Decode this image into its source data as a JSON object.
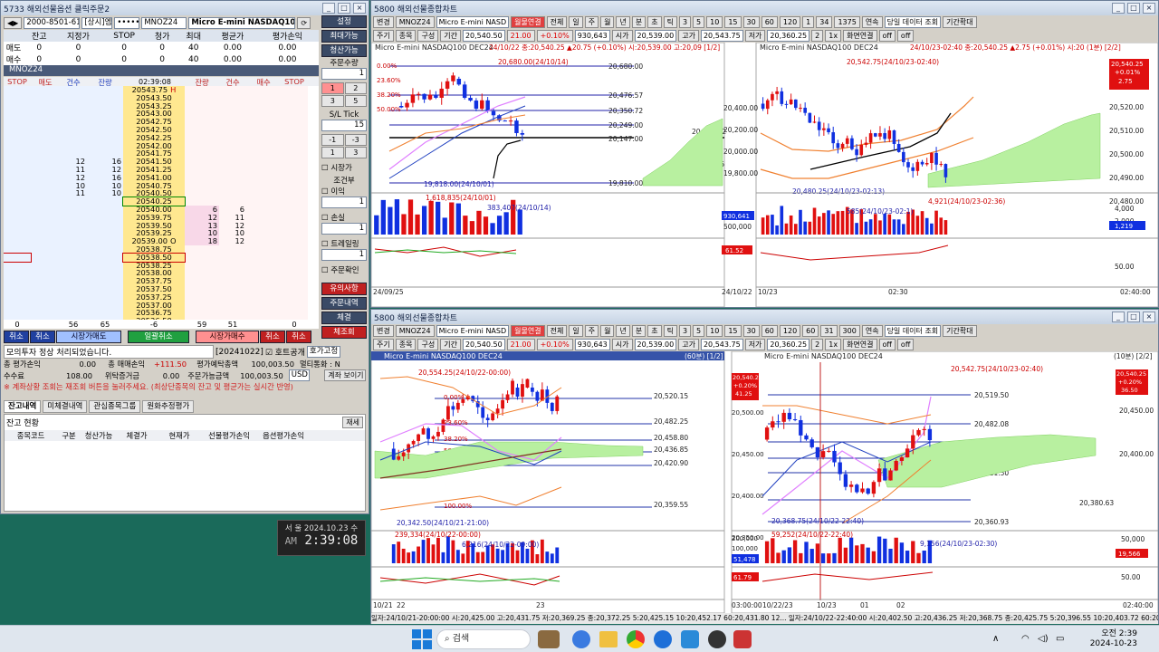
{
  "order": {
    "title": "5733 해외선물옵션 클릭주문2",
    "account": "2000-8501-6145",
    "acct_name": "[상시]엠",
    "password": "•••••",
    "symbol": "MNOZ24",
    "symbol_name": "Micro E-mini NASDAQ100",
    "side_buttons": [
      "설정",
      "최대가능",
      "청산가능"
    ],
    "pos_headers": [
      "",
      "잔고",
      "지정가",
      "STOP",
      "청가",
      "최대",
      "평균가",
      "평가손익"
    ],
    "pos_rows": [
      [
        "매도",
        "0",
        "0",
        "0",
        "0",
        "40",
        "0.00",
        "0.00"
      ],
      [
        "매수",
        "0",
        "0",
        "0",
        "0",
        "40",
        "0.00",
        "0.00"
      ]
    ],
    "sym_tag": "MNOZ24",
    "ob_headers": [
      "STOP",
      "매도",
      "건수",
      "잔량",
      "",
      "잔량",
      "건수",
      "매수",
      "STOP"
    ],
    "time": "02:39:08",
    "prices": [
      "20543.75",
      "20543.50",
      "20543.25",
      "20543.00",
      "20542.75",
      "20542.50",
      "20542.25",
      "20542.00",
      "20541.75",
      "20541.50",
      "20541.25",
      "20541.00",
      "20540.75",
      "20540.50",
      "20540.25",
      "20540.00",
      "20539.75",
      "20539.50",
      "20539.25",
      "20539.00",
      "20538.75",
      "20538.50",
      "20538.25",
      "20538.00",
      "20537.75",
      "20537.50",
      "20537.25",
      "20537.00",
      "20536.75",
      "20536.50"
    ],
    "h_mark": "H",
    "o_mark": "O",
    "ask_cnt": [
      "",
      "",
      "",
      "",
      "",
      "",
      "",
      "",
      "",
      "12",
      "11",
      "12",
      "10",
      "11"
    ],
    "ask_qty": [
      "",
      "",
      "",
      "",
      "",
      "",
      "",
      "",
      "",
      "16",
      "12",
      "16",
      "10",
      "10"
    ],
    "bid_qty": [
      "6",
      "12",
      "13",
      "10",
      "18"
    ],
    "bid_cnt": [
      "6",
      "11",
      "12",
      "10",
      "12"
    ],
    "totals": [
      "0",
      "56",
      "65",
      "-6",
      "59",
      "51",
      "0"
    ],
    "bottom_buttons": [
      "취소",
      "취소",
      "시장가매도",
      "일괄취소",
      "시장가매수",
      "취소",
      "취소"
    ],
    "side": {
      "qty_label": "주문수량",
      "qty": "1",
      "nums": [
        "1",
        "2",
        "3",
        "5"
      ],
      "sl_label": "S/L Tick",
      "sl": "15",
      "steps": [
        "-1",
        "-3",
        "1",
        "3"
      ],
      "mkt": "시장가",
      "cond": "조건부",
      "profit": "이익",
      "loss": "손실",
      "trail": "트레일링",
      "confirm": "주문확인",
      "one": "1",
      "b1": "유의사항",
      "b2": "주문내역",
      "b3": "체결",
      "b4": "체조회"
    },
    "msg": "모의투자 정상 처리되었습니다.",
    "msg_time": "[20241022]",
    "msg_chk": "호트공개",
    "msg_sel": "호가고정",
    "stats": [
      [
        "총 평가손익",
        "0.00",
        "총 매매손익",
        "+111.50",
        "평가예탁총액",
        "100,003.50",
        "멀티통화 : N"
      ],
      [
        "수수료",
        "108.00",
        "위탁증거금",
        "0.00",
        "주문가능금액",
        "100,003.50",
        "USD"
      ]
    ],
    "acct_btn": "계좌 보이기",
    "warn": "※ 계좌상황 조회는 재조회 버튼을 눌러주세요. (최상단종목의 잔고 및 평균가는 실시간 반영)",
    "tabs": [
      "잔고내역",
      "미체결내역",
      "관심종목그룹",
      "원화추정평가"
    ],
    "bal_title": "잔고 현황",
    "refresh": "재세",
    "bal_headers": [
      "종목코드",
      "구분",
      "청산가능",
      "체결가",
      "현재가",
      "선물평가손익",
      "옵션평가손익"
    ]
  },
  "clock": {
    "date": "서 울 2024.10.23 수",
    "ampm": "AM",
    "time": "2:39:08"
  },
  "chart_top": {
    "title": "5800 해외선물종합차트",
    "toolbar": [
      "변경",
      "MNOZ24",
      "Micro E-mini NASD",
      "월물연결",
      "전체",
      "일",
      "주",
      "월",
      "년",
      "분",
      "초",
      "틱",
      "3",
      "5",
      "10",
      "15",
      "30",
      "60",
      "120",
      "1",
      "34",
      "1375",
      "연속",
      "당일 데이터 조회",
      "기간확대"
    ],
    "bar2": [
      "주기",
      "종목",
      "구성",
      "기간",
      "20,540.50",
      "21.00",
      "+0.10%",
      "930,643",
      "시가",
      "20,539.00",
      "고가",
      "20,543.75",
      "저가",
      "20,360.25",
      "2",
      "1x",
      "화면연결",
      "off",
      "off"
    ],
    "left": {
      "head": "Micro E-mini NASDAQ100 DEC24",
      "info": "24/10/22 종:20,540.25 ▲20.75 (+0.10%) 시:20,539.00 고:20,09 [1/2]",
      "ylabels": [
        "20,680.00",
        "20,476.57",
        "20,350.72",
        "20,249.00",
        "20,147.00",
        "19,919.25",
        "19,810.00"
      ],
      "marks": [
        "20,680.00(24/10/14)",
        "19,818.00(24/10/01)",
        "1,618,835(24/10/01)",
        "383,407(24/10/14)"
      ],
      "pct": [
        "0.00%",
        "23.60%",
        "38.20%",
        "50.00%",
        "61.80%"
      ],
      "right_labels": [
        "20,151.52"
      ],
      "vol_labels": [
        "1,500,000",
        "1,000,000",
        "500,000"
      ],
      "dates": [
        "24/09/25",
        "10"
      ]
    },
    "right": {
      "head": "Micro E-mini NASDAQ100 DEC24",
      "info": "24/10/23-02:40 종:20,540.25 ▲2.75 (+0.01%) 시:20 (1분) [2/2]",
      "ylabels": [
        "20,540.25",
        "+0.01%",
        "2.75",
        "20,530.00",
        "20,520.00",
        "20,510.00",
        "20,500.00",
        "20,490.00",
        "20,480.00"
      ],
      "leftlabels": [
        "20,400.00",
        "20,200.00",
        "20,000.00",
        "19,800.00"
      ],
      "marks": [
        "20,542.75(24/10/23-02:40)",
        "20,480.25(24/10/23-02:13)",
        "585(24/10/23-02:1)",
        "4,921(24/10/23-02:36)"
      ],
      "vol_labels": [
        "4,000",
        "2,000",
        "1,219"
      ],
      "lvol": [
        "930,641",
        "500,000"
      ],
      "osc_labels": [
        "61.52",
        "50.00"
      ],
      "dates": [
        "24/10/22",
        "10/23",
        "02:30",
        "02:40:00"
      ]
    }
  },
  "chart_bot": {
    "title": "5800 해외선물종합차트",
    "toolbar": [
      "변경",
      "MNOZ24",
      "Micro E-mini NASD",
      "월물연결",
      "전체",
      "일",
      "주",
      "월",
      "년",
      "분",
      "초",
      "틱",
      "3",
      "5",
      "10",
      "15",
      "30",
      "60",
      "120",
      "60",
      "31",
      "300",
      "연속",
      "당일 데이터 조회",
      "기간확대"
    ],
    "bar2": [
      "주기",
      "종목",
      "구성",
      "기간",
      "20,540.50",
      "21.00",
      "+0.10%",
      "930,643",
      "시가",
      "20,539.00",
      "고가",
      "20,543.75",
      "저가",
      "20,360.25",
      "2",
      "1x",
      "화면연결",
      "off",
      "off"
    ],
    "left": {
      "head": "Micro E-mini NASDAQ100 DEC24",
      "info": "(60분) [1/2]",
      "ylabels": [
        "20,540.25",
        "+0.20%",
        "41.25",
        "20,500.00",
        "20,450.00",
        "20,400.00",
        "20,350.00"
      ],
      "hlabels": [
        "20,520.15",
        "20,482.25",
        "20,458.80",
        "20,436.85",
        "20,420.90",
        "20,359.55"
      ],
      "marks": [
        "20,554.25(24/10/22-00:00)",
        "20,342.50(24/10/21-21:00)",
        "239,334(24/10/22-00:00)",
        "6,216(24/10/22-09:00)"
      ],
      "pct": [
        "0.00%",
        "23.60%",
        "38.20%",
        "50.00%",
        "61.80%",
        "100.00%"
      ],
      "vol_labels": [
        "200,000",
        "100,000",
        "51,478"
      ],
      "osc": [
        "61.79"
      ],
      "dates": [
        "10/21",
        "22",
        "23",
        "03:00:00"
      ]
    },
    "right": {
      "head": "Micro E-mini NASDAQ100 DEC24",
      "info": "(10분) [2/2]",
      "ylabels": [
        "20,540.25",
        "+0.20%",
        "36.50",
        "20,450.00",
        "20,400.00"
      ],
      "hlabels": [
        "20,519.50",
        "20,482.08",
        "20,458.93",
        "20,440.22",
        "20,421.50",
        "20,380.63",
        "20,360.93"
      ],
      "marks": [
        "20,542.75(24/10/23-02:40)",
        "20,368.75(24/10/22-22:40)",
        "59,252(24/10/22-22:40)",
        "9,156(24/10/23-02:30)"
      ],
      "vol_labels": [
        "50,000",
        "19,566",
        "50.00"
      ],
      "dates": [
        "10/22/23",
        "10/23",
        "01",
        "02",
        "02:40:00"
      ]
    },
    "status": "일자:24/10/21-20:00:00 시:20,425.00 고:20,431.75 저:20,369.25 종:20,372.25 5:20,425.15 10:20,452.17 60:20,431.80 12...  일자:24/10/22-22:40:00 시:20,402.50 고:20,436.25 저:20,368.75 종:20,425.75 5:20,396.55 10:20,403.72 60:20,433.46 12..."
  },
  "taskbar": {
    "search": "검색",
    "time": "오전 2:39",
    "date": "2024-10-23"
  }
}
